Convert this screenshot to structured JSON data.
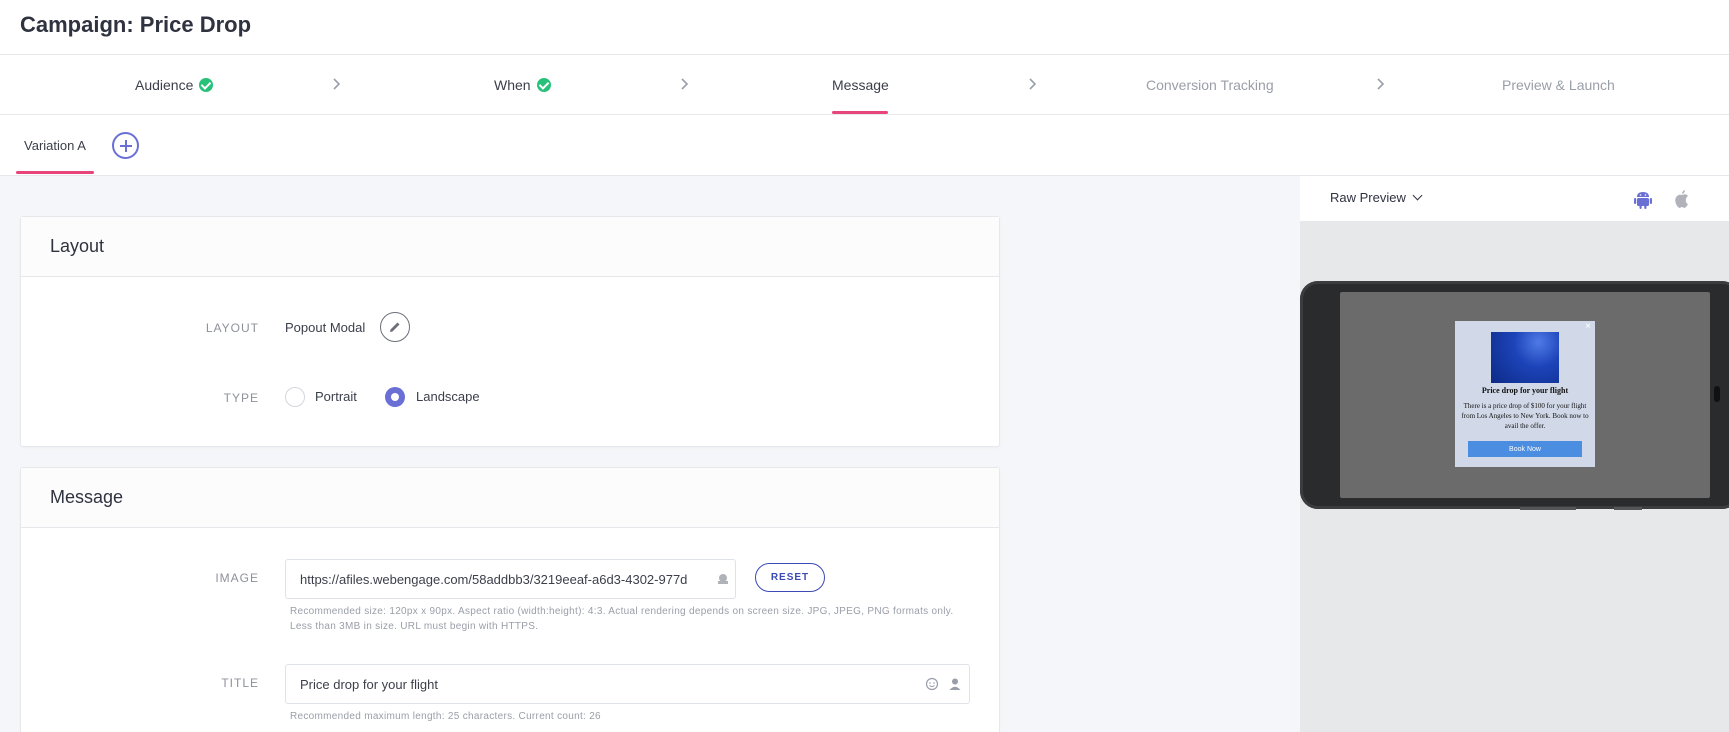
{
  "header": {
    "title": "Campaign: Price Drop"
  },
  "stepper": {
    "steps": [
      {
        "label": "Audience",
        "state": "complete"
      },
      {
        "label": "When",
        "state": "complete"
      },
      {
        "label": "Message",
        "state": "active"
      },
      {
        "label": "Conversion Tracking",
        "state": "upcoming"
      },
      {
        "label": "Preview & Launch",
        "state": "upcoming"
      }
    ]
  },
  "variations": {
    "tabs": [
      {
        "label": "Variation A",
        "active": true
      }
    ],
    "add_icon": "plus-circle-icon"
  },
  "layout_card": {
    "title": "Layout",
    "layout_label": "LAYOUT",
    "layout_value": "Popout Modal",
    "type_label": "TYPE",
    "type_options": [
      {
        "label": "Portrait",
        "selected": false
      },
      {
        "label": "Landscape",
        "selected": true
      }
    ]
  },
  "message_card": {
    "title": "Message",
    "image_label": "IMAGE",
    "image_value": "https://afiles.webengage.com/58addbb3/3219eeaf-a6d3-4302-977d",
    "reset_label": "RESET",
    "image_help_line1": "Recommended size: 120px x 90px. Aspect ratio (width:height): 4:3. Actual rendering depends on screen size. JPG, JPEG, PNG formats only.",
    "image_help_line2": "Less than 3MB in size. URL must begin with HTTPS.",
    "title_label": "TITLE",
    "title_value": "Price drop for your flight",
    "title_help": "Recommended maximum length: 25 characters. Current count: 26"
  },
  "preview": {
    "mode_label": "Raw Preview",
    "platforms": [
      {
        "name": "android-icon",
        "active": true
      },
      {
        "name": "apple-icon",
        "active": false
      }
    ],
    "modal": {
      "close": "×",
      "title": "Price drop for your flight",
      "text": "There is a price drop of $100 for your flight from Los Angeles to New York. Book now to avail the offer.",
      "button": "Book Now"
    }
  },
  "colors": {
    "accent": "#e8457a",
    "primary": "#6a6fd6",
    "success": "#27c17a",
    "reset_border": "#3c4ab5"
  }
}
